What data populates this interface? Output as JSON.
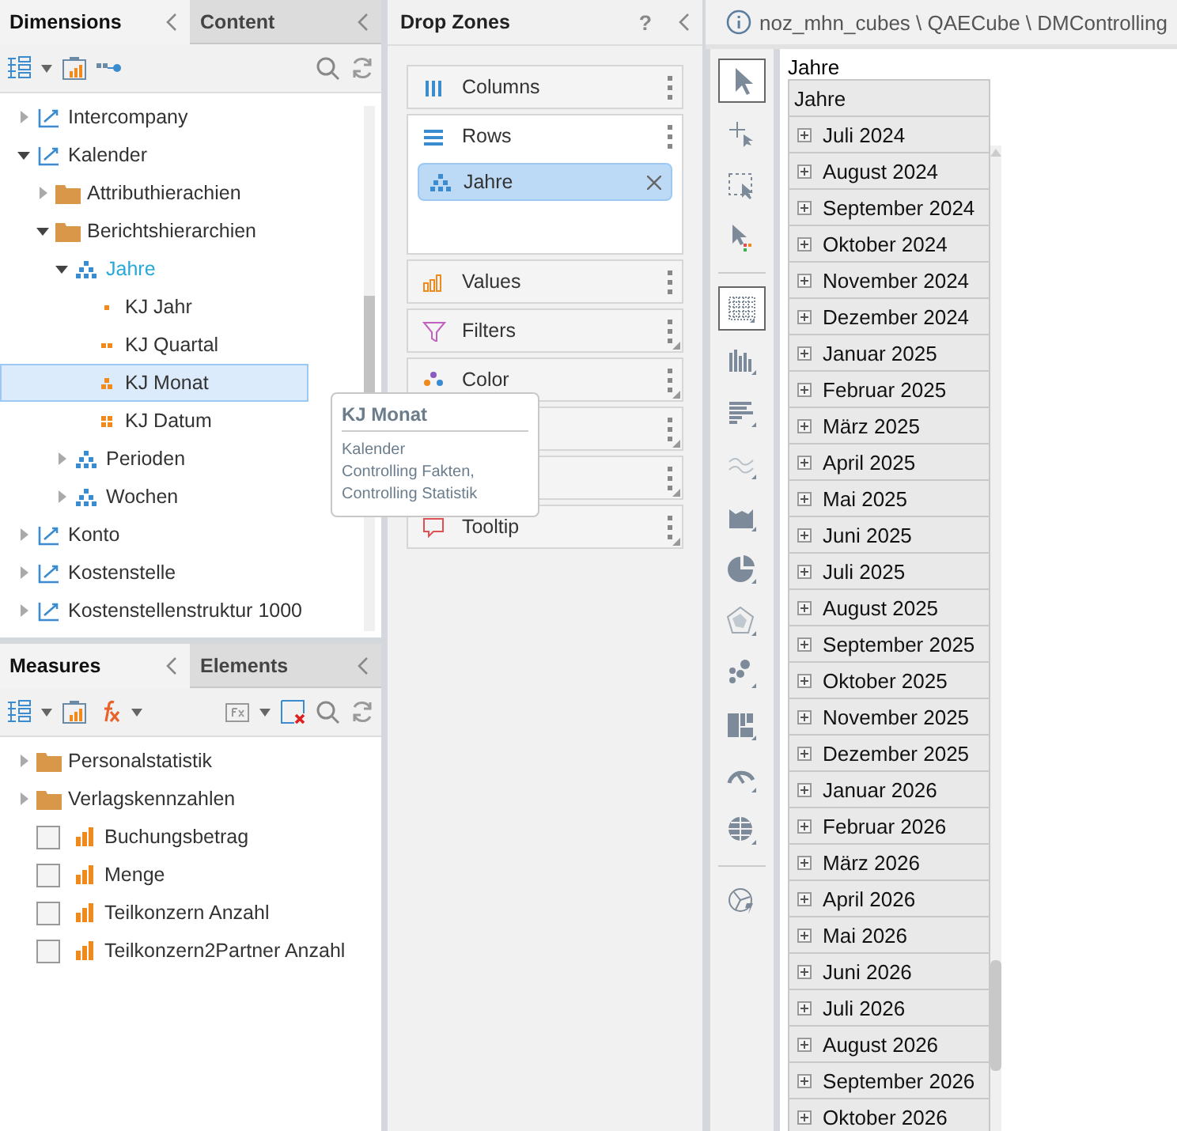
{
  "dimensions_panel": {
    "tabs": [
      {
        "label": "Dimensions",
        "selected": true
      },
      {
        "label": "Content",
        "selected": false
      }
    ],
    "tree": [
      {
        "label": "Intercompany",
        "kind": "dimension",
        "expanded": false,
        "selected": false
      },
      {
        "label": "Kalender",
        "kind": "dimension",
        "expanded": true,
        "selected": false,
        "children": [
          {
            "label": "Attributhierachien",
            "kind": "folder",
            "expanded": false,
            "selected": false
          },
          {
            "label": "Berichtshierarchien",
            "kind": "folder",
            "expanded": true,
            "selected": false,
            "children": [
              {
                "label": "Jahre",
                "kind": "hierarchy",
                "expanded": true,
                "selected": false,
                "in_use": true,
                "children": [
                  {
                    "label": "KJ Jahr",
                    "kind": "level1",
                    "selected": false
                  },
                  {
                    "label": "KJ Quartal",
                    "kind": "level2",
                    "selected": false
                  },
                  {
                    "label": "KJ Monat",
                    "kind": "level3",
                    "selected": true
                  },
                  {
                    "label": "KJ Datum",
                    "kind": "level4",
                    "selected": false
                  }
                ]
              },
              {
                "label": "Perioden",
                "kind": "hierarchy",
                "expanded": false,
                "selected": false,
                "in_use": false
              },
              {
                "label": "Wochen",
                "kind": "hierarchy",
                "expanded": false,
                "selected": false,
                "in_use": false
              }
            ]
          }
        ]
      },
      {
        "label": "Konto",
        "kind": "dimension",
        "expanded": false,
        "selected": false
      },
      {
        "label": "Kostenstelle",
        "kind": "dimension",
        "expanded": false,
        "selected": false
      },
      {
        "label": "Kostenstellenstruktur 1000",
        "kind": "dimension",
        "expanded": false,
        "selected": false
      }
    ]
  },
  "tooltip": {
    "title": "KJ Monat",
    "lines": [
      "Kalender",
      "Controlling Fakten,",
      "Controlling Statistik"
    ]
  },
  "measures_panel": {
    "tabs": [
      {
        "label": "Measures",
        "selected": true
      },
      {
        "label": "Elements",
        "selected": false
      }
    ],
    "tree": [
      {
        "label": "Personalstatistik",
        "kind": "folder",
        "expanded": false,
        "selected": false
      },
      {
        "label": "Verlagskennzahlen",
        "kind": "folder",
        "expanded": false,
        "selected": false
      },
      {
        "label": "Buchungsbetrag",
        "kind": "measure",
        "checked": false,
        "selected": false
      },
      {
        "label": "Menge",
        "kind": "measure",
        "checked": false,
        "selected": false
      },
      {
        "label": "Teilkonzern Anzahl",
        "kind": "measure",
        "checked": false,
        "selected": false
      },
      {
        "label": "Teilkonzern2Partner Anzahl",
        "kind": "measure",
        "checked": false,
        "selected": false
      }
    ]
  },
  "drop_zones": {
    "title": "Drop Zones",
    "help": "?",
    "zones": [
      {
        "label": "Columns",
        "kind": "columns"
      },
      {
        "label": "Rows",
        "kind": "rows",
        "items": [
          "Jahre"
        ]
      },
      {
        "label": "Values",
        "kind": "values"
      },
      {
        "label": "Filters",
        "kind": "filters"
      },
      {
        "label": "Color",
        "kind": "color"
      },
      {
        "kind": "indicator"
      },
      {
        "kind": "size"
      },
      {
        "label": "Tooltip",
        "kind": "tooltip"
      }
    ]
  },
  "report": {
    "path": "noz_mhn_cubes \\ QAECube \\ DMControlling",
    "tools": [
      {
        "kind": "pointer",
        "selected": true
      },
      {
        "kind": "add-pointer",
        "selected": false
      },
      {
        "kind": "marquee",
        "selected": false
      },
      {
        "kind": "color-pointer",
        "selected": false
      },
      {
        "kind": "separator"
      },
      {
        "kind": "table",
        "selected": true
      },
      {
        "kind": "column-chart",
        "selected": false
      },
      {
        "kind": "bar-chart",
        "selected": false
      },
      {
        "kind": "line-chart",
        "selected": false
      },
      {
        "kind": "area-chart",
        "selected": false
      },
      {
        "kind": "pie-chart",
        "selected": false
      },
      {
        "kind": "radar-chart",
        "selected": false
      },
      {
        "kind": "scatter-chart",
        "selected": false
      },
      {
        "kind": "treemap",
        "selected": false
      },
      {
        "kind": "gauge",
        "selected": false
      },
      {
        "kind": "map",
        "selected": false
      },
      {
        "kind": "separator"
      },
      {
        "kind": "chart-settings",
        "selected": false
      }
    ],
    "grid": {
      "title": "Jahre",
      "column": "Jahre",
      "rows": [
        "Juli 2024",
        "August 2024",
        "September 2024",
        "Oktober 2024",
        "November 2024",
        "Dezember 2024",
        "Januar 2025",
        "Februar 2025",
        "März 2025",
        "April 2025",
        "Mai 2025",
        "Juni 2025",
        "Juli 2025",
        "August 2025",
        "September 2025",
        "Oktober 2025",
        "November 2025",
        "Dezember 2025",
        "Januar 2026",
        "Februar 2026",
        "März 2026",
        "April 2026",
        "Mai 2026",
        "Juni 2026",
        "Juli 2026",
        "August 2026",
        "September 2026",
        "Oktober 2026"
      ]
    }
  }
}
